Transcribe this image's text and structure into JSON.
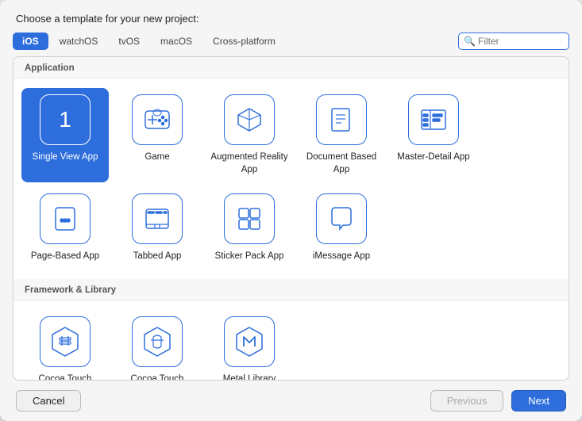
{
  "dialog": {
    "title": "Choose a template for your new project:"
  },
  "tabs": [
    {
      "label": "iOS",
      "active": true
    },
    {
      "label": "watchOS",
      "active": false
    },
    {
      "label": "tvOS",
      "active": false
    },
    {
      "label": "macOS",
      "active": false
    },
    {
      "label": "Cross-platform",
      "active": false
    }
  ],
  "filter": {
    "placeholder": "Filter"
  },
  "sections": [
    {
      "header": "Application",
      "items": [
        {
          "id": "single-view-app",
          "label": "Single View App",
          "icon": "number1",
          "selected": true
        },
        {
          "id": "game",
          "label": "Game",
          "icon": "game"
        },
        {
          "id": "augmented-reality-app",
          "label": "Augmented Reality App",
          "icon": "ar"
        },
        {
          "id": "document-based-app",
          "label": "Document Based App",
          "icon": "doc"
        },
        {
          "id": "master-detail-app",
          "label": "Master-Detail App",
          "icon": "masterdetail"
        },
        {
          "id": "page-based-app",
          "label": "Page-Based App",
          "icon": "pages"
        },
        {
          "id": "tabbed-app",
          "label": "Tabbed App",
          "icon": "tabs"
        },
        {
          "id": "sticker-pack-app",
          "label": "Sticker Pack App",
          "icon": "sticker"
        },
        {
          "id": "imessage-app",
          "label": "iMessage App",
          "icon": "imessage"
        }
      ]
    },
    {
      "header": "Framework & Library",
      "items": [
        {
          "id": "cocoa-touch-framework",
          "label": "Cocoa Touch Framework",
          "icon": "hexwrench"
        },
        {
          "id": "cocoa-touch-static-library",
          "label": "Cocoa Touch Static Library",
          "icon": "hexbuilding"
        },
        {
          "id": "metal-library",
          "label": "Metal Library",
          "icon": "hexm"
        }
      ]
    }
  ],
  "footer": {
    "cancel_label": "Cancel",
    "previous_label": "Previous",
    "next_label": "Next"
  }
}
